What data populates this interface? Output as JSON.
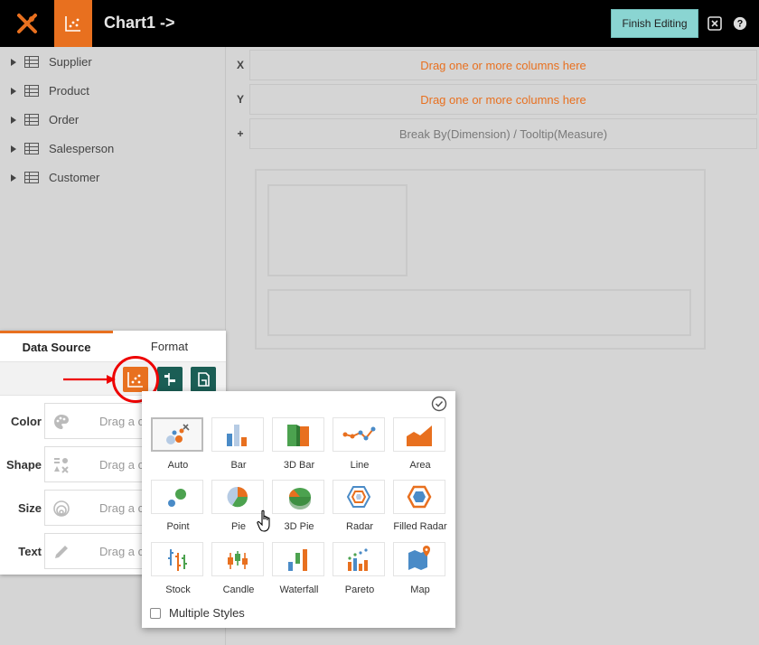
{
  "header": {
    "title": "Chart1 ->",
    "finish_label": "Finish Editing",
    "colors": {
      "bar": "#000000",
      "accent": "#e8701f",
      "finish_bg": "#8ad5d2"
    }
  },
  "tree": {
    "items": [
      {
        "label": "Supplier"
      },
      {
        "label": "Product"
      },
      {
        "label": "Order"
      },
      {
        "label": "Salesperson"
      },
      {
        "label": "Customer"
      }
    ]
  },
  "bindings": {
    "x": {
      "axis": "X",
      "placeholder": "Drag one or more columns here"
    },
    "y": {
      "axis": "Y",
      "placeholder": "Drag one or more columns here"
    },
    "extra": {
      "axis": "+",
      "placeholder": "Break By(Dimension) / Tooltip(Measure)"
    }
  },
  "panel": {
    "tabs": [
      {
        "label": "Data Source"
      },
      {
        "label": "Format"
      }
    ],
    "properties": [
      {
        "label": "Color",
        "placeholder": "Drag a column here",
        "icon": "palette-icon"
      },
      {
        "label": "Shape",
        "placeholder": "Drag a column here",
        "icon": "shapes-icon"
      },
      {
        "label": "Size",
        "placeholder": "Drag a column here",
        "icon": "size-circles-icon"
      },
      {
        "label": "Text",
        "placeholder": "Drag a column here",
        "icon": "pencil-icon"
      }
    ]
  },
  "chart_types": {
    "selected": "Auto",
    "items": [
      {
        "label": "Auto"
      },
      {
        "label": "Bar"
      },
      {
        "label": "3D Bar"
      },
      {
        "label": "Line"
      },
      {
        "label": "Area"
      },
      {
        "label": "Point"
      },
      {
        "label": "Pie"
      },
      {
        "label": "3D Pie"
      },
      {
        "label": "Radar"
      },
      {
        "label": "Filled Radar"
      },
      {
        "label": "Stock"
      },
      {
        "label": "Candle"
      },
      {
        "label": "Waterfall"
      },
      {
        "label": "Pareto"
      },
      {
        "label": "Map"
      }
    ],
    "multiple_styles_label": "Multiple Styles",
    "multiple_styles_checked": false
  }
}
